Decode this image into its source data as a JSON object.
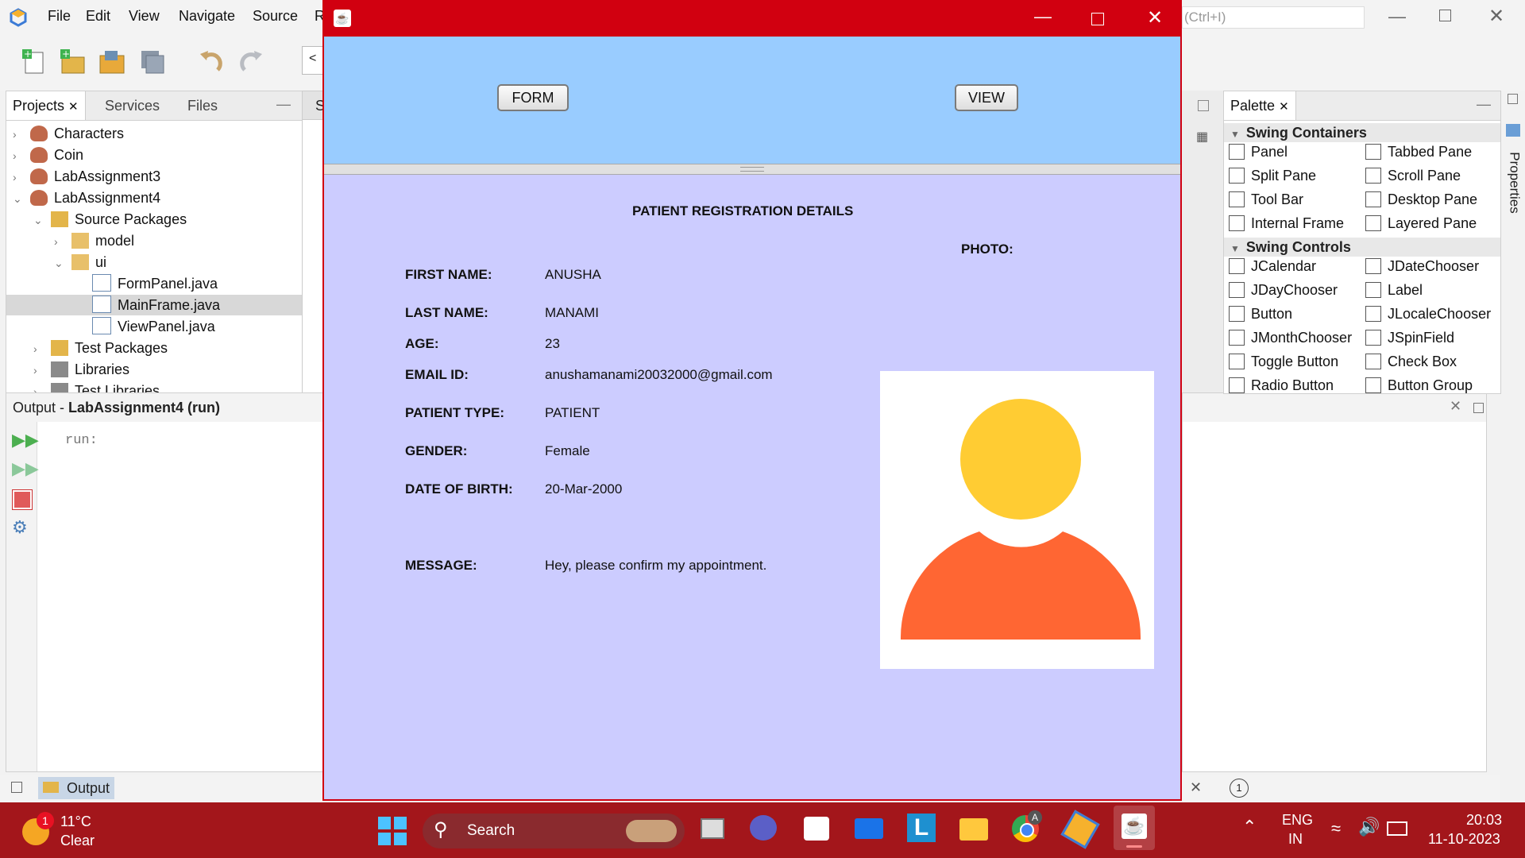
{
  "ide": {
    "menu": [
      "File",
      "Edit",
      "View",
      "Navigate",
      "Source",
      "R"
    ],
    "search_hint": "(Ctrl+I)",
    "projects_panel": {
      "tabs": [
        "Projects",
        "Services",
        "Files"
      ],
      "tree": [
        {
          "label": "Characters",
          "level": 0,
          "expanded": false,
          "icon": "java-project-icon"
        },
        {
          "label": "Coin",
          "level": 0,
          "expanded": false,
          "icon": "java-project-icon"
        },
        {
          "label": "LabAssignment3",
          "level": 0,
          "expanded": false,
          "icon": "java-project-icon"
        },
        {
          "label": "LabAssignment4",
          "level": 0,
          "expanded": true,
          "icon": "java-project-icon"
        },
        {
          "label": "Source Packages",
          "level": 1,
          "expanded": true,
          "icon": "source-folder-icon"
        },
        {
          "label": "model",
          "level": 2,
          "expanded": false,
          "icon": "package-icon"
        },
        {
          "label": "ui",
          "level": 2,
          "expanded": true,
          "icon": "package-icon"
        },
        {
          "label": "FormPanel.java",
          "level": 3,
          "icon": "java-file-icon"
        },
        {
          "label": "MainFrame.java",
          "level": 3,
          "icon": "java-file-icon",
          "selected": true
        },
        {
          "label": "ViewPanel.java",
          "level": 3,
          "icon": "java-file-icon"
        },
        {
          "label": "Test Packages",
          "level": 1,
          "expanded": false,
          "icon": "source-folder-icon"
        },
        {
          "label": "Libraries",
          "level": 1,
          "expanded": false,
          "icon": "library-icon"
        },
        {
          "label": "Test Libraries",
          "level": 1,
          "expanded": false,
          "icon": "library-icon"
        }
      ]
    },
    "output_panel": {
      "title_prefix": "Output - ",
      "title_bold": "LabAssignment4 (run)",
      "text": "run:",
      "bottom_tab": "Output"
    },
    "editor_tab_fragment": "S",
    "nav_fragment": "<",
    "palette": {
      "tab": "Palette",
      "side_tab": "Properties",
      "sections": [
        {
          "title": "Swing Containers",
          "items": [
            "Panel",
            "Tabbed Pane",
            "Split Pane",
            "Scroll Pane",
            "Tool Bar",
            "Desktop Pane",
            "Internal Frame",
            "Layered Pane"
          ]
        },
        {
          "title": "Swing Controls",
          "items": [
            "JCalendar",
            "JDateChooser",
            "JDayChooser",
            "Label",
            "Button",
            "JLocaleChooser",
            "JMonthChooser",
            "JSpinField",
            "Toggle Button",
            "Check Box",
            "Radio Button",
            "Button Group"
          ]
        }
      ]
    }
  },
  "app": {
    "top_buttons": {
      "form": "FORM",
      "view": "VIEW"
    },
    "heading": "PATIENT REGISTRATION DETAILS",
    "photo_label": "PHOTO:",
    "fields": {
      "first_name": {
        "label": "FIRST NAME:",
        "value": "ANUSHA"
      },
      "last_name": {
        "label": "LAST NAME:",
        "value": "MANAMI"
      },
      "age": {
        "label": "AGE:",
        "value": "23"
      },
      "email": {
        "label": "EMAIL ID:",
        "value": "anushamanami20032000@gmail.com"
      },
      "patient_type": {
        "label": "PATIENT TYPE:",
        "value": "PATIENT"
      },
      "gender": {
        "label": "GENDER:",
        "value": "Female"
      },
      "dob": {
        "label": "DATE OF BIRTH:",
        "value": "20-Mar-2000"
      },
      "message": {
        "label": "MESSAGE:",
        "value": "Hey, please confirm my appointment."
      }
    },
    "colors": {
      "top_panel": "#99ccff",
      "detail_panel": "#ccccff",
      "titlebar": "#d10010",
      "avatar_head": "#ffcc33",
      "avatar_body": "#ff6633"
    }
  },
  "taskbar": {
    "weather": {
      "temp": "11°C",
      "condition": "Clear",
      "badge": "1"
    },
    "search_placeholder": "Search",
    "language": {
      "line1": "ENG",
      "line2": "IN"
    },
    "time": "20:03",
    "date": "11-10-2023",
    "chrome_badge": "A"
  }
}
